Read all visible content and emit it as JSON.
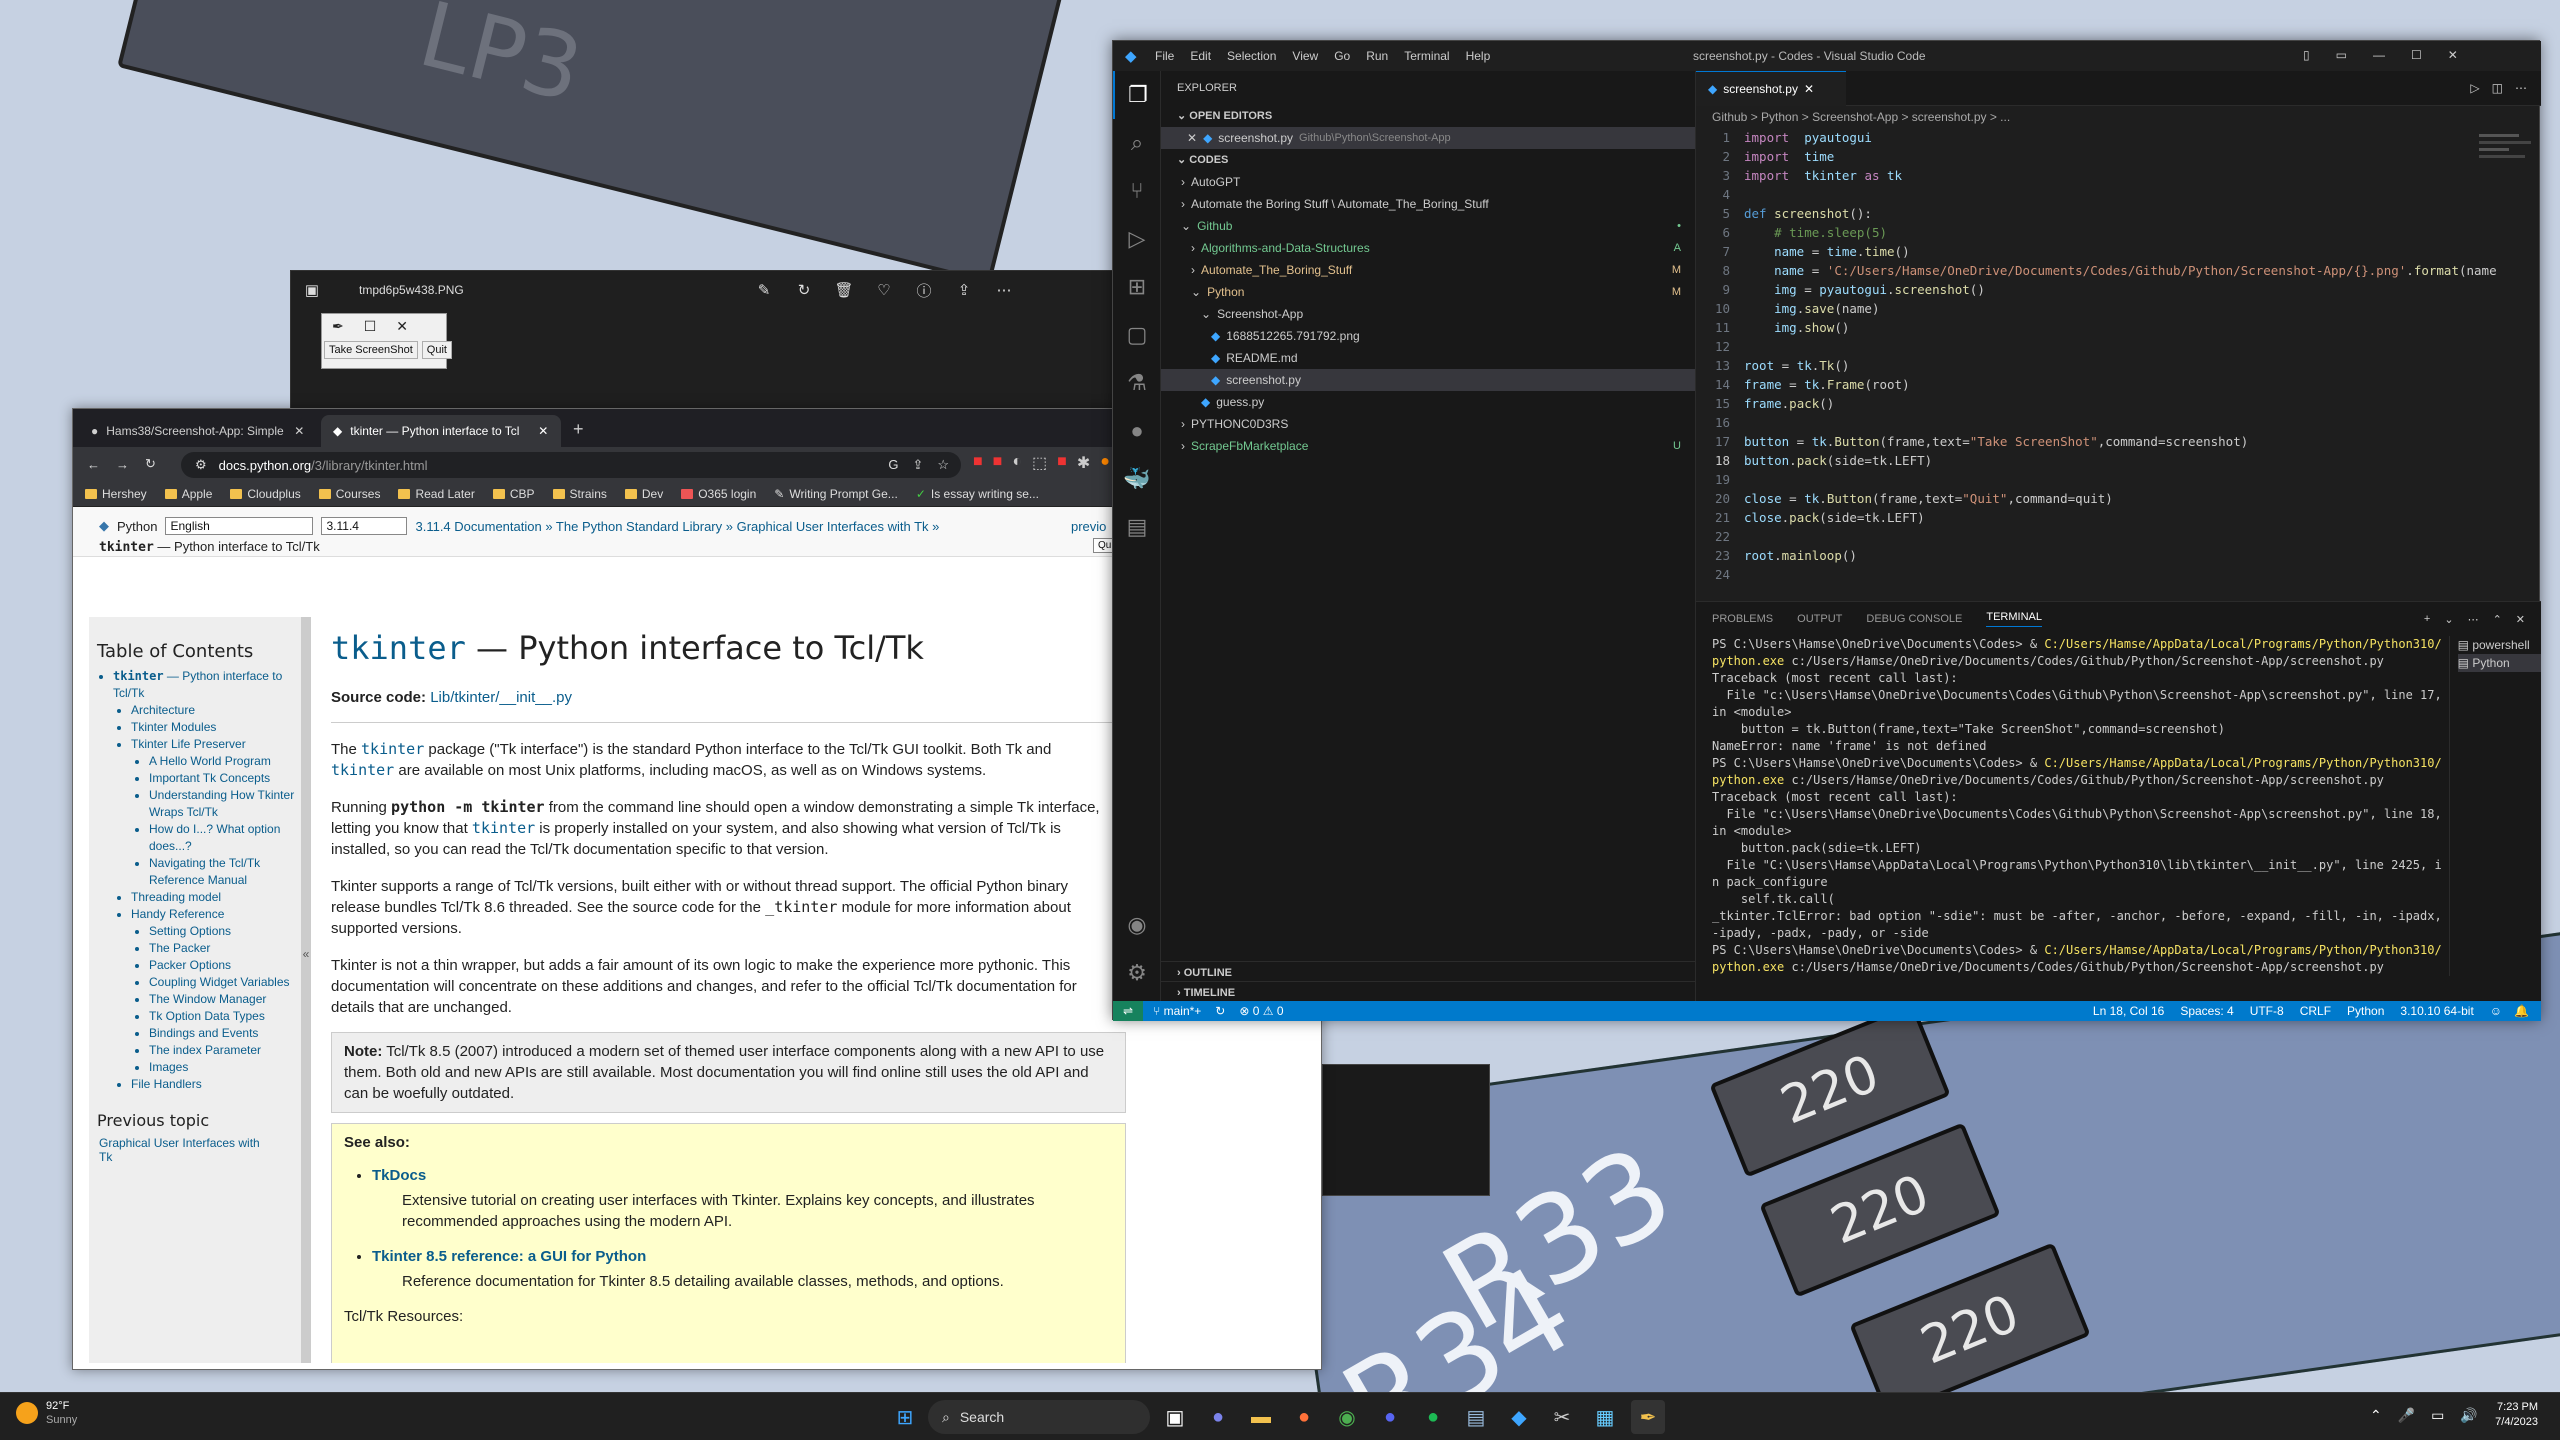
{
  "wallpaper": {
    "chip_text": "LP3",
    "resistors": [
      "220",
      "220",
      "220"
    ],
    "silk_labels": [
      "R33",
      "R34"
    ]
  },
  "photos_viewer": {
    "title": "tmpd6p5w438.PNG"
  },
  "tk_window": {
    "take_screenshot": "Take ScreenShot",
    "quit": "Quit"
  },
  "browser": {
    "tabs": [
      {
        "title": "Hams38/Screenshot-App: Simple",
        "active": false
      },
      {
        "title": "tkinter — Python interface to Tcl",
        "active": true
      }
    ],
    "url_domain": "docs.python.org",
    "url_path": "/3/library/tkinter.html",
    "bookmarks": [
      "Hershey",
      "Apple",
      "Cloudplus",
      "Courses",
      "Read Later",
      "CBP",
      "Strains",
      "Dev",
      "O365 login",
      "Writing Prompt Ge...",
      "Is essay writing se..."
    ],
    "docbar": {
      "python_label": "Python",
      "language": "English",
      "version": "3.11.4",
      "breadcrumb": "3.11.4 Documentation » The Python Standard Library » Graphical User Interfaces with Tk »",
      "previous": "previo",
      "subtitle_mono": "tkinter",
      "subtitle_rest": " — Python interface to Tcl/Tk",
      "quick": "Qu"
    },
    "toc": {
      "heading": "Table of Contents",
      "top_mono": "tkinter",
      "top_rest": " — Python interface to Tcl/Tk",
      "items": [
        "Architecture",
        "Tkinter Modules",
        "Tkinter Life Preserver"
      ],
      "life_sub": [
        "A Hello World Program",
        "Important Tk Concepts",
        "Understanding How Tkinter Wraps Tcl/Tk",
        "How do I...? What option does...?",
        "Navigating the Tcl/Tk Reference Manual"
      ],
      "items2": [
        "Threading model",
        "Handy Reference"
      ],
      "handy_sub": [
        "Setting Options",
        "The Packer",
        "Packer Options",
        "Coupling Widget Variables",
        "The Window Manager",
        "Tk Option Data Types",
        "Bindings and Events",
        "The index Parameter",
        "Images"
      ],
      "items3": [
        "File Handlers"
      ],
      "prev_heading": "Previous topic",
      "prev_link": "Graphical User Interfaces with Tk",
      "collapse": "«"
    },
    "doc": {
      "h1_mono": "tkinter",
      "h1_rest": " — Python interface to Tcl/Tk",
      "source_label": "Source code:",
      "source_link": "Lib/tkinter/__init__.py",
      "p1a": "The ",
      "p1b": "tkinter",
      "p1c": " package (\"Tk interface\") is the standard Python interface to the Tcl/Tk GUI toolkit. Both Tk and ",
      "p1d": "tkinter",
      "p1e": " are available on most Unix platforms, including macOS, as well as on Windows systems.",
      "p2a": "Running ",
      "p2b": "python -m tkinter",
      "p2c": " from the command line should open a window demonstrating a simple Tk interface, letting you know that ",
      "p2d": "tkinter",
      "p2e": " is properly installed on your system, and also showing what version of Tcl/Tk is installed, so you can read the Tcl/Tk documentation specific to that version.",
      "p3a": "Tkinter supports a range of Tcl/Tk versions, built either with or without thread support. The official Python binary release bundles Tcl/Tk 8.6 threaded. See the source code for the ",
      "p3b": "_tkinter",
      "p3c": " module for more information about supported versions.",
      "p4": "Tkinter is not a thin wrapper, but adds a fair amount of its own logic to make the experience more pythonic. This documentation will concentrate on these additions and changes, and refer to the official Tcl/Tk documentation for details that are unchanged.",
      "note_label": "Note:",
      "note_text": " Tcl/Tk 8.5 (2007) introduced a modern set of themed user interface components along with a new API to use them. Both old and new APIs are still available. Most documentation you will find online still uses the old API and can be woefully outdated.",
      "seealso": "See also:",
      "sa1_link": "TkDocs",
      "sa1_desc": "Extensive tutorial on creating user interfaces with Tkinter. Explains key concepts, and illustrates recommended approaches using the modern API.",
      "sa2_link": "Tkinter 8.5 reference: a GUI for Python",
      "sa2_desc": "Reference documentation for Tkinter 8.5 detailing available classes, methods, and options.",
      "resources": "Tcl/Tk Resources:"
    }
  },
  "vscode": {
    "menu": [
      "File",
      "Edit",
      "Selection",
      "View",
      "Go",
      "Run",
      "Terminal",
      "Help"
    ],
    "window_title": "screenshot.py - Codes - Visual Studio Code",
    "explorer": "EXPLORER",
    "open_editors": "OPEN EDITORS",
    "open_file": "screenshot.py",
    "open_file_path": "Github\\Python\\Screenshot-App",
    "codes": "CODES",
    "tree": [
      {
        "label": "AutoGPT",
        "indent": 1,
        "kind": "folder",
        "dec": ""
      },
      {
        "label": "Automate the Boring Stuff \\ Automate_The_Boring_Stuff",
        "indent": 1,
        "kind": "folder",
        "dec": ""
      },
      {
        "label": "Github",
        "indent": 1,
        "kind": "folder-open",
        "dec": "•"
      },
      {
        "label": "Algorithms-and-Data-Structures",
        "indent": 2,
        "kind": "folder",
        "dec": "A"
      },
      {
        "label": "Automate_The_Boring_Stuff",
        "indent": 2,
        "kind": "folder",
        "dec": "M"
      },
      {
        "label": "Python",
        "indent": 2,
        "kind": "folder-open",
        "dec": "M"
      },
      {
        "label": "Screenshot-App",
        "indent": 3,
        "kind": "folder-open",
        "dec": ""
      },
      {
        "label": "1688512265.791792.png",
        "indent": 4,
        "kind": "file",
        "dec": ""
      },
      {
        "label": "README.md",
        "indent": 4,
        "kind": "file",
        "dec": ""
      },
      {
        "label": "screenshot.py",
        "indent": 4,
        "kind": "file",
        "dec": ""
      },
      {
        "label": "guess.py",
        "indent": 3,
        "kind": "file",
        "dec": ""
      },
      {
        "label": "PYTHONC0D3RS",
        "indent": 1,
        "kind": "folder",
        "dec": ""
      },
      {
        "label": "ScrapeFbMarketplace",
        "indent": 1,
        "kind": "folder",
        "dec": "U"
      }
    ],
    "outline": "OUTLINE",
    "timeline": "TIMELINE",
    "tab": "screenshot.py",
    "breadcrumb": "Github > Python > Screenshot-App > screenshot.py > ...",
    "code": [
      [
        [
          "kw",
          "import"
        ],
        [
          "",
          "  "
        ],
        [
          "va",
          "pyautogui"
        ]
      ],
      [
        [
          "kw",
          "import"
        ],
        [
          "",
          "  "
        ],
        [
          "va",
          "time"
        ]
      ],
      [
        [
          "kw",
          "import"
        ],
        [
          "",
          "  "
        ],
        [
          "va",
          "tkinter"
        ],
        [
          "",
          " "
        ],
        [
          "kw",
          "as"
        ],
        [
          "",
          " "
        ],
        [
          "va",
          "tk"
        ]
      ],
      [],
      [
        [
          "kwb",
          "def"
        ],
        [
          "",
          " "
        ],
        [
          "fn",
          "screenshot"
        ],
        [
          "",
          "():"
        ]
      ],
      [
        [
          "",
          "    "
        ],
        [
          "cm",
          "# time.sleep(5)"
        ]
      ],
      [
        [
          "",
          "    "
        ],
        [
          "va",
          "name"
        ],
        [
          "",
          " = "
        ],
        [
          "va",
          "time"
        ],
        [
          "",
          "."
        ],
        [
          "fn",
          "time"
        ],
        [
          "",
          "()"
        ]
      ],
      [
        [
          "",
          "    "
        ],
        [
          "va",
          "name"
        ],
        [
          "",
          " = "
        ],
        [
          "st",
          "'C:/Users/Hamse/OneDrive/Documents/Codes/Github/Python/Screenshot-App/{}.png'"
        ],
        [
          "",
          "."
        ],
        [
          "fn",
          "format"
        ],
        [
          "",
          "(name"
        ]
      ],
      [
        [
          "",
          "    "
        ],
        [
          "va",
          "img"
        ],
        [
          "",
          " = "
        ],
        [
          "va",
          "pyautogui"
        ],
        [
          "",
          "."
        ],
        [
          "fn",
          "screenshot"
        ],
        [
          "",
          "()"
        ]
      ],
      [
        [
          "",
          "    "
        ],
        [
          "va",
          "img"
        ],
        [
          "",
          "."
        ],
        [
          "fn",
          "save"
        ],
        [
          "",
          "(name)"
        ]
      ],
      [
        [
          "",
          "    "
        ],
        [
          "va",
          "img"
        ],
        [
          "",
          "."
        ],
        [
          "fn",
          "show"
        ],
        [
          "",
          "()"
        ]
      ],
      [],
      [
        [
          "va",
          "root"
        ],
        [
          "",
          " = "
        ],
        [
          "va",
          "tk"
        ],
        [
          "",
          "."
        ],
        [
          "fn",
          "Tk"
        ],
        [
          "",
          "()"
        ]
      ],
      [
        [
          "va",
          "frame"
        ],
        [
          "",
          " = "
        ],
        [
          "va",
          "tk"
        ],
        [
          "",
          "."
        ],
        [
          "fn",
          "Frame"
        ],
        [
          "",
          "(root)"
        ]
      ],
      [
        [
          "va",
          "frame"
        ],
        [
          "",
          "."
        ],
        [
          "fn",
          "pack"
        ],
        [
          "",
          "()"
        ]
      ],
      [],
      [
        [
          "va",
          "button"
        ],
        [
          "",
          " = "
        ],
        [
          "va",
          "tk"
        ],
        [
          "",
          "."
        ],
        [
          "fn",
          "Button"
        ],
        [
          "",
          "(frame,text="
        ],
        [
          "st",
          "\"Take ScreenShot\""
        ],
        [
          "",
          ",command=screenshot)"
        ]
      ],
      [
        [
          "va",
          "button"
        ],
        [
          "",
          "."
        ],
        [
          "fn",
          "pack"
        ],
        [
          "",
          "(side=tk.LEFT)"
        ]
      ],
      [],
      [
        [
          "va",
          "close"
        ],
        [
          "",
          " = "
        ],
        [
          "va",
          "tk"
        ],
        [
          "",
          "."
        ],
        [
          "fn",
          "Button"
        ],
        [
          "",
          "(frame,text="
        ],
        [
          "st",
          "\"Quit\""
        ],
        [
          "",
          ",command=quit)"
        ]
      ],
      [
        [
          "va",
          "close"
        ],
        [
          "",
          "."
        ],
        [
          "fn",
          "pack"
        ],
        [
          "",
          "(side=tk.LEFT)"
        ]
      ],
      [],
      [
        [
          "va",
          "root"
        ],
        [
          "",
          "."
        ],
        [
          "fn",
          "mainloop"
        ],
        [
          "",
          "()"
        ]
      ],
      []
    ],
    "panel_tabs": [
      "PROBLEMS",
      "OUTPUT",
      "DEBUG CONSOLE",
      "TERMINAL"
    ],
    "terminal": [
      {
        "p": "PS C:\\Users\\Hamse\\OneDrive\\Documents\\Codes> & ",
        "y": "C:/Users/Hamse/AppData/Local/Programs/Python/Python310/python.exe",
        "r": " c:/Users/Hamse/OneDrive/Documents/Codes/Github/Python/Screenshot-App/screenshot.py"
      },
      {
        "p": "Traceback (most recent call last):"
      },
      {
        "p": "  File \"c:\\Users\\Hamse\\OneDrive\\Documents\\Codes\\Github\\Python\\Screenshot-App\\screenshot.py\", line 17, in <module>"
      },
      {
        "p": "    button = tk.Button(frame,text=\"Take ScreenShot\",command=screenshot)"
      },
      {
        "p": "NameError: name 'frame' is not defined"
      },
      {
        "p": "PS C:\\Users\\Hamse\\OneDrive\\Documents\\Codes> & ",
        "y": "C:/Users/Hamse/AppData/Local/Programs/Python/Python310/python.exe",
        "r": " c:/Users/Hamse/OneDrive/Documents/Codes/Github/Python/Screenshot-App/screenshot.py"
      },
      {
        "p": "Traceback (most recent call last):"
      },
      {
        "p": "  File \"c:\\Users\\Hamse\\OneDrive\\Documents\\Codes\\Github\\Python\\Screenshot-App\\screenshot.py\", line 18, in <module>"
      },
      {
        "p": "    button.pack(sdie=tk.LEFT)"
      },
      {
        "p": "  File \"C:\\Users\\Hamse\\AppData\\Local\\Programs\\Python\\Python310\\lib\\tkinter\\__init__.py\", line 2425, in pack_configure"
      },
      {
        "p": "    self.tk.call("
      },
      {
        "p": "_tkinter.TclError: bad option \"-sdie\": must be -after, -anchor, -before, -expand, -fill, -in, -ipadx, -ipady, -padx, -pady, or -side"
      },
      {
        "p": "PS C:\\Users\\Hamse\\OneDrive\\Documents\\Codes> & ",
        "y": "C:/Users/Hamse/AppData/Local/Programs/Python/Python310/python.exe",
        "r": " c:/Users/Hamse/OneDrive/Documents/Codes/Github/Python/Screenshot-App/screenshot.py"
      }
    ],
    "terminals": [
      "powershell",
      "Python"
    ],
    "status": {
      "branch": "main*+",
      "problems": "⊗ 0 ⚠ 0",
      "position": "Ln 18, Col 16",
      "spaces": "Spaces: 4",
      "encoding": "UTF-8",
      "eol": "CRLF",
      "language": "Python",
      "interpreter": "3.10.10 64-bit"
    }
  },
  "taskbar": {
    "weather_temp": "92°F",
    "weather_desc": "Sunny",
    "search": "Search",
    "time": "7:23 PM",
    "date": "7/4/2023"
  }
}
